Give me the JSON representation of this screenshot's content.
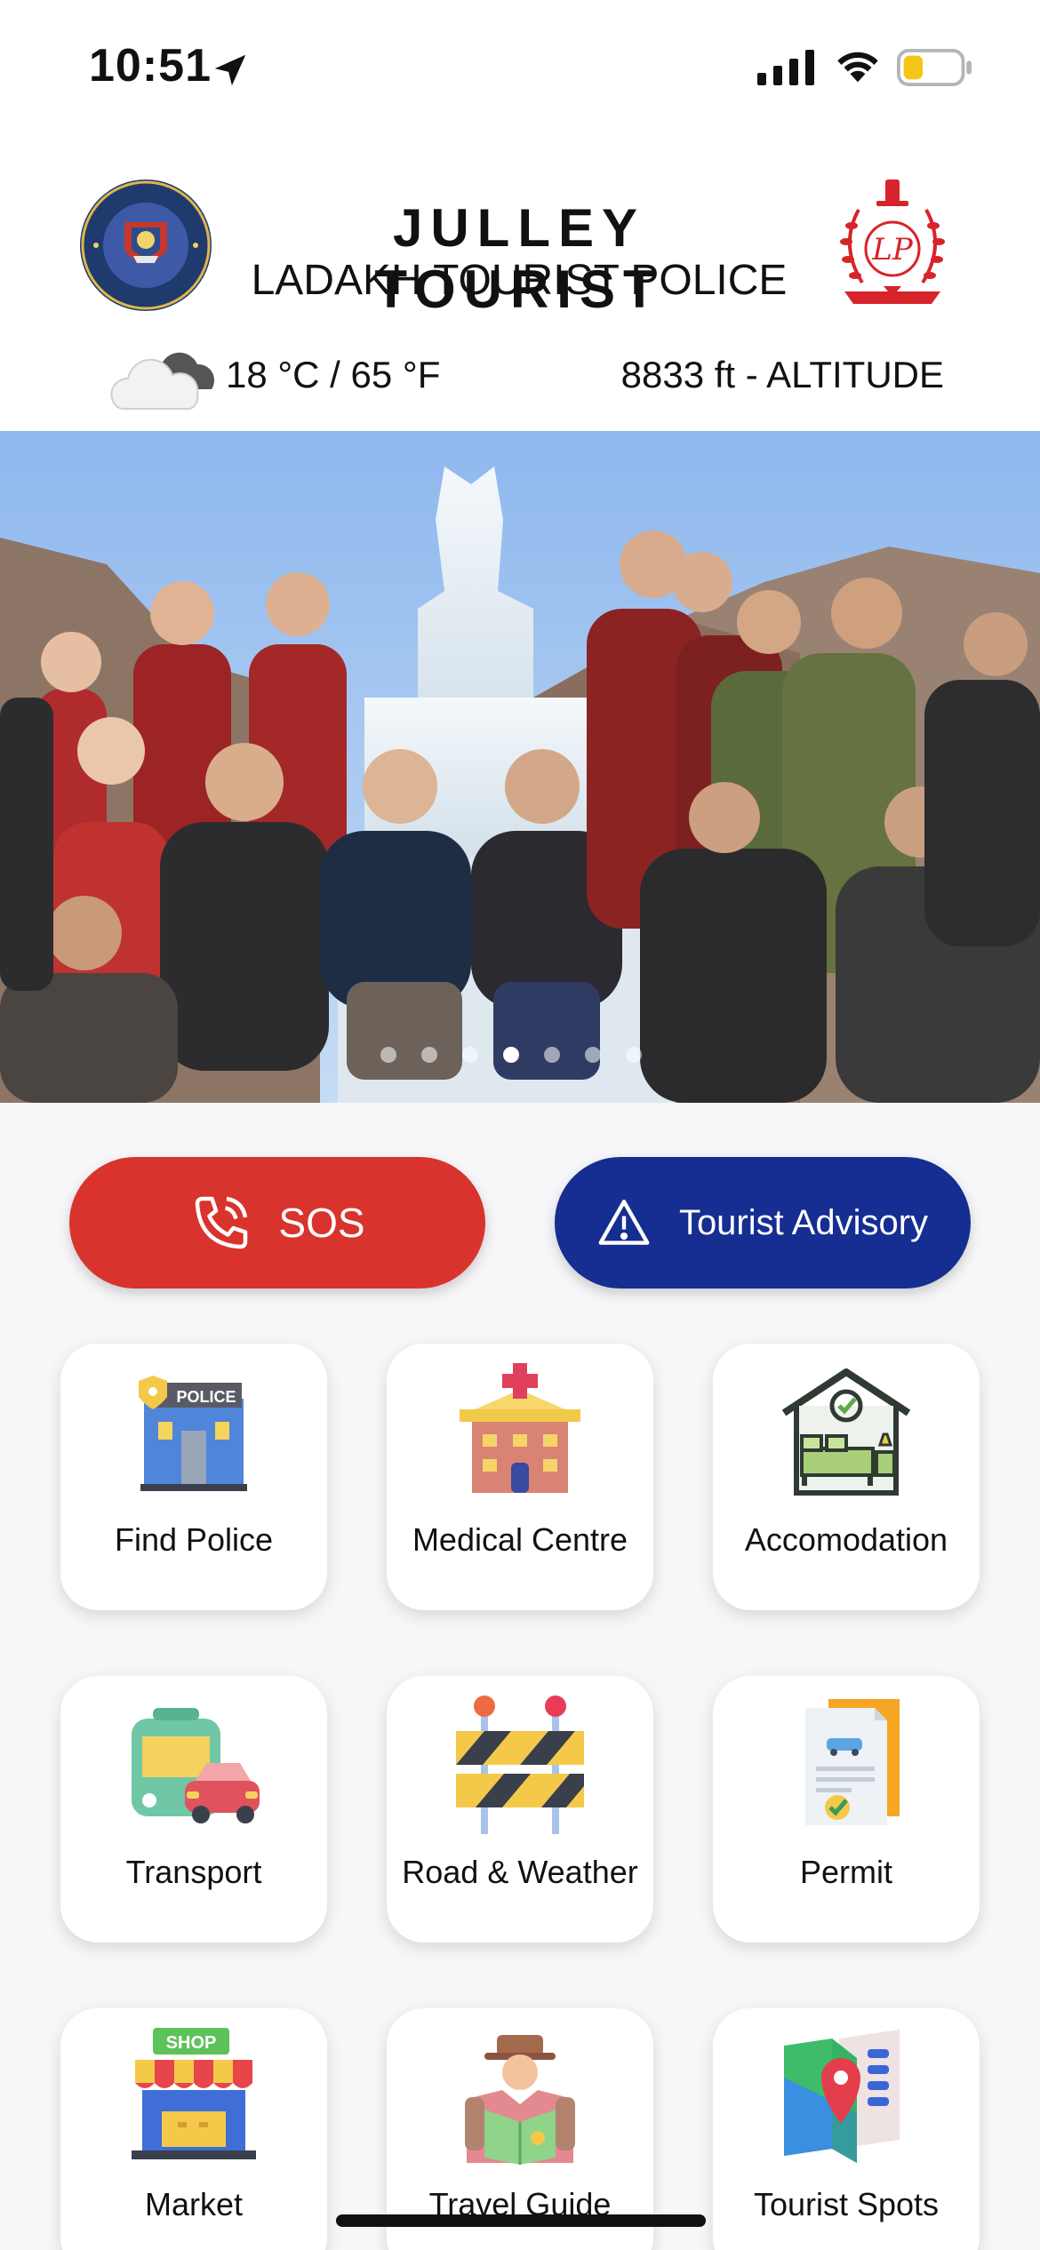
{
  "status_bar": {
    "time": "10:51",
    "battery_level": 0.35,
    "battery_color": "#f5c518"
  },
  "header": {
    "title": "JULLEY TOURIST",
    "subtitle": "LADAKH TOURIST POLICE",
    "left_logo_text_top": "TOURIST WING",
    "left_logo_text_bottom": "LADAKH POLICE",
    "right_logo_initials": "LP",
    "temperature": "18 °C / 65 °F",
    "altitude": "8833 ft - ALTITUDE"
  },
  "banner": {
    "slide_count": 7,
    "active_slide": 3
  },
  "actions": {
    "sos": {
      "label": "SOS",
      "icon": "phone-icon",
      "color": "#d9332d"
    },
    "advisory": {
      "label": "Tourist Advisory",
      "icon": "warning-icon",
      "color": "#162d91"
    }
  },
  "grid": [
    {
      "label": "Find Police",
      "icon": "police-station-icon",
      "badge": "POLICE"
    },
    {
      "label": "Medical Centre",
      "icon": "hospital-icon"
    },
    {
      "label": "Accomodation",
      "icon": "bed-house-icon"
    },
    {
      "label": "Transport",
      "icon": "bus-car-icon"
    },
    {
      "label": "Road & Weather",
      "icon": "road-barrier-icon"
    },
    {
      "label": "Permit",
      "icon": "permit-document-icon"
    },
    {
      "label": "Market",
      "icon": "shop-icon",
      "badge": "SHOP"
    },
    {
      "label": "Travel Guide",
      "icon": "traveler-icon"
    },
    {
      "label": "Tourist Spots",
      "icon": "map-pin-icon"
    }
  ]
}
